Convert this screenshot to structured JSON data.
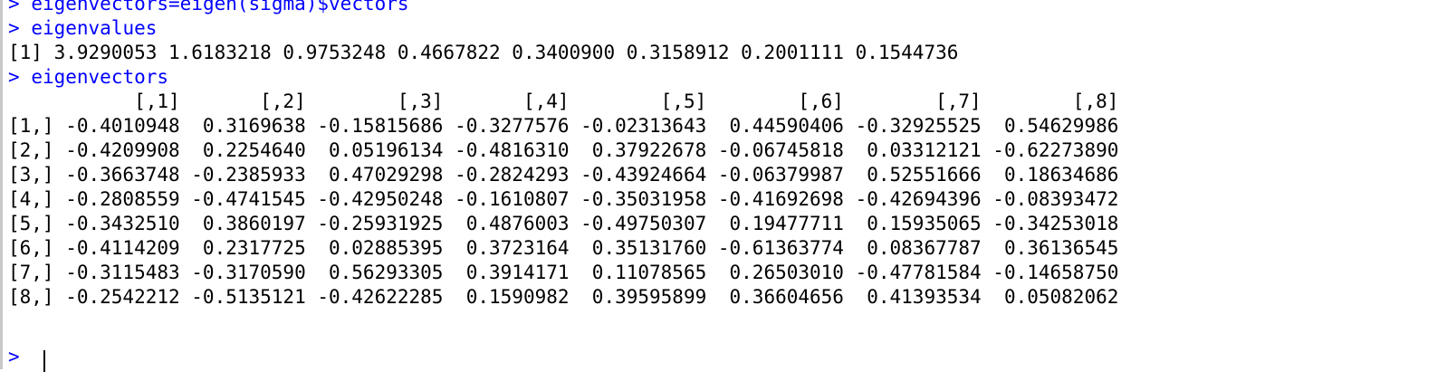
{
  "console": {
    "prompt": ">",
    "commands": {
      "eigenvectors_assign": "eigenvectors=eigen(sigma)$vectors",
      "print_eigenvalues": "eigenvalues",
      "print_eigenvectors": "eigenvectors"
    },
    "eigenvalues_output": "[1] 3.9290053 1.6183218 0.9753248 0.4667822 0.3400900 0.3158912 0.2001111 0.1544736",
    "eigenvectors_table": {
      "header": "           [,1]       [,2]        [,3]       [,4]        [,5]        [,6]        [,7]        [,8]",
      "rows": [
        "[1,] -0.4010948  0.3169638 -0.15815686 -0.3277576 -0.02313643  0.44590406 -0.32925525  0.54629986",
        "[2,] -0.4209908  0.2254640  0.05196134 -0.4816310  0.37922678 -0.06745818  0.03312121 -0.62273890",
        "[3,] -0.3663748 -0.2385933  0.47029298 -0.2824293 -0.43924664 -0.06379987  0.52551666  0.18634686",
        "[4,] -0.2808559 -0.4741545 -0.42950248 -0.1610807 -0.35031958 -0.41692698 -0.42694396 -0.08393472",
        "[5,] -0.3432510  0.3860197 -0.25931925  0.4876003 -0.49750307  0.19477711  0.15935065 -0.34253018",
        "[6,] -0.4114209  0.2317725  0.02885395  0.3723164  0.35131760 -0.61363774  0.08367787  0.36136545",
        "[7,] -0.3115483 -0.3170590  0.56293305  0.3914171  0.11078565  0.26503010 -0.47781584 -0.14658750",
        "[8,] -0.2542212 -0.5135121 -0.42622285  0.1590982  0.39595899  0.36604656  0.41393534  0.05082062"
      ]
    },
    "input_line": ""
  },
  "colors": {
    "command": "#0000ff",
    "output": "#000000",
    "background": "#ffffff"
  }
}
